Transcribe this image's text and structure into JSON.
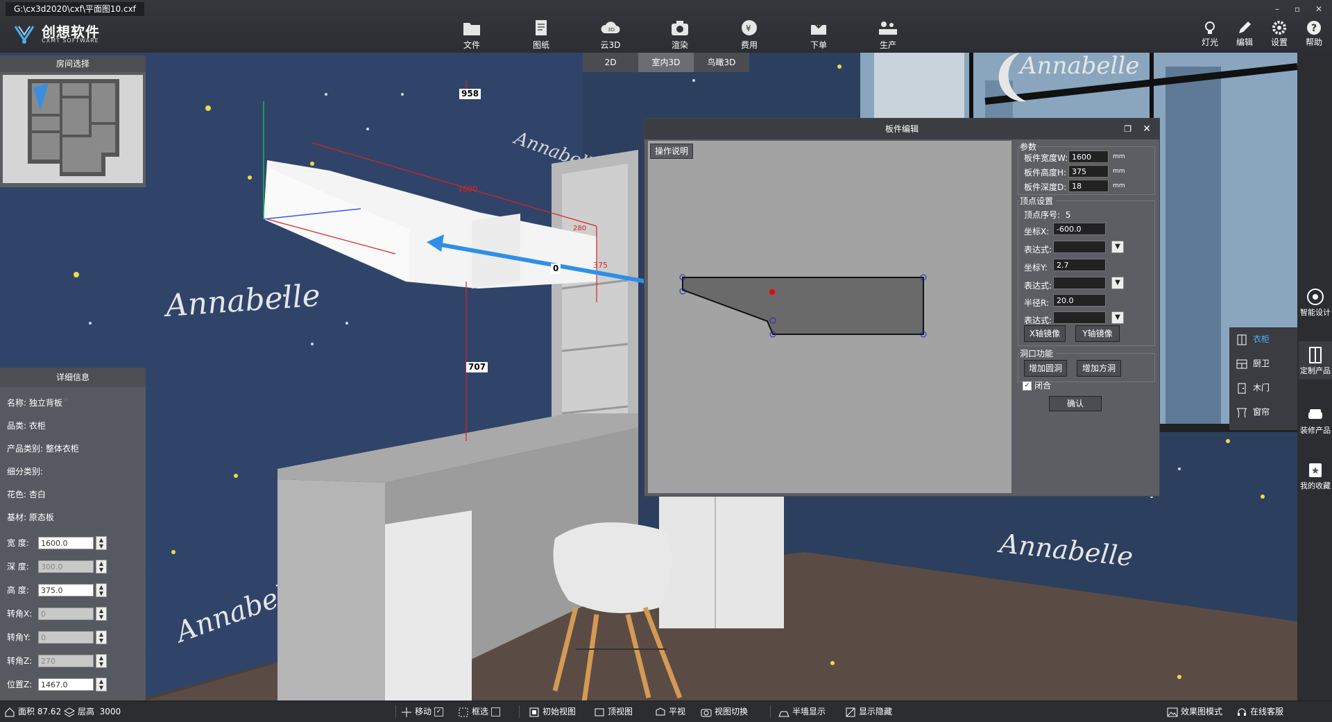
{
  "window": {
    "file_path": "G:\\cx3d2020\\cxf\\平面图10.cxf",
    "min": "–",
    "max": "▫",
    "close": "✕"
  },
  "logo": {
    "cn": "创想软件",
    "en": "CXMT SOFTWARE"
  },
  "toolbar": [
    "文件",
    "图纸",
    "云3D",
    "渲染",
    "费用",
    "下单",
    "生产"
  ],
  "toolbar_right": [
    "灯光",
    "编辑",
    "设置",
    "帮助"
  ],
  "view_tabs": {
    "items": [
      "2D",
      "室内3D",
      "鸟瞰3D"
    ],
    "active": "室内3D"
  },
  "room_panel": {
    "title": "房间选择"
  },
  "scene": {
    "wall_text": "Annabelle",
    "dims": {
      "top": "958",
      "middle": "707",
      "width": "1600",
      "height": "375",
      "small": "280",
      "zero": "0"
    }
  },
  "detail": {
    "title": "详细信息",
    "rows": [
      {
        "label": "名称:",
        "value": "独立背板"
      },
      {
        "label": "品类:",
        "value": "衣柜"
      },
      {
        "label": "产品类别:",
        "value": "整体衣柜"
      },
      {
        "label": "细分类别:",
        "value": ""
      },
      {
        "label": "花色:",
        "value": "杏白"
      },
      {
        "label": "基材:",
        "value": "原态板"
      }
    ],
    "fields": [
      {
        "label": "宽 度:",
        "value": "1600.0",
        "disabled": false
      },
      {
        "label": "深 度:",
        "value": "300.0",
        "disabled": true
      },
      {
        "label": "高 度:",
        "value": "375.0",
        "disabled": false
      },
      {
        "label": "转角X:",
        "value": "0",
        "disabled": true
      },
      {
        "label": "转角Y:",
        "value": "0",
        "disabled": true
      },
      {
        "label": "转角Z:",
        "value": "270",
        "disabled": true
      },
      {
        "label": "位置Z:",
        "value": "1467.0",
        "disabled": false
      }
    ]
  },
  "dialog": {
    "title": "板件编辑",
    "op_button": "操作说明",
    "params": {
      "group": "参数",
      "width_label": "板件宽度W:",
      "width": "1600",
      "height_label": "板件高度H:",
      "height": "375",
      "depth_label": "板件深度D:",
      "depth": "18",
      "unit": "mm"
    },
    "vertex": {
      "group": "顶点设置",
      "index_label": "顶点序号:",
      "index": "5",
      "x_label": "坐标X:",
      "x": "-600.0",
      "expr_label": "表达式:",
      "y_label": "坐标Y:",
      "y": "2.7",
      "r_label": "半径R:",
      "r": "20.0",
      "mirror_x": "X轴镜像",
      "mirror_y": "Y轴镜像"
    },
    "hole": {
      "group": "洞口功能",
      "add_round": "增加圆洞",
      "add_square": "增加方洞"
    },
    "closed_label": "闭合",
    "closed": true,
    "confirm": "确认"
  },
  "right_sidebar": [
    "智能设计",
    "定制产品",
    "装修产品",
    "我的收藏"
  ],
  "flyout": {
    "items": [
      "衣柜",
      "厨卫",
      "木门",
      "窗帘"
    ],
    "active": "衣柜"
  },
  "status": {
    "area_label": "面积",
    "area": "87.62",
    "floor_label": "层高",
    "floor": "3000",
    "items": [
      "移动",
      "框选",
      "初始视图",
      "顶视图",
      "平视",
      "视图切换",
      "半墙显示",
      "显示隐藏"
    ],
    "right": [
      "效果图模式",
      "在线客服"
    ]
  },
  "colors": {
    "accent": "#2f8fe8",
    "wallpaper": "#2c3f5e",
    "panel": "#5c5e63"
  }
}
